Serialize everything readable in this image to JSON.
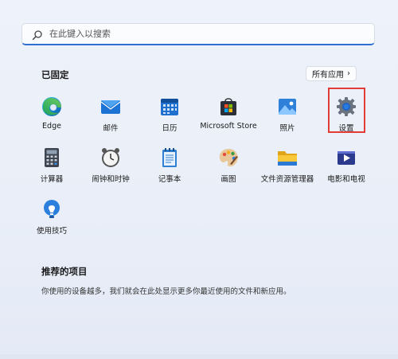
{
  "search": {
    "placeholder": "在此键入以搜索"
  },
  "pinned": {
    "title": "已固定",
    "all_apps_label": "所有应用",
    "all_apps_chevron": "›",
    "apps": [
      {
        "label": "Edge",
        "icon": "edge-icon"
      },
      {
        "label": "邮件",
        "icon": "mail-icon"
      },
      {
        "label": "日历",
        "icon": "calendar-icon"
      },
      {
        "label": "Microsoft Store",
        "icon": "store-icon"
      },
      {
        "label": "照片",
        "icon": "photos-icon"
      },
      {
        "label": "设置",
        "icon": "gear-icon"
      },
      {
        "label": "计算器",
        "icon": "calculator-icon"
      },
      {
        "label": "闹钟和时钟",
        "icon": "clock-icon"
      },
      {
        "label": "记事本",
        "icon": "notepad-icon"
      },
      {
        "label": "画图",
        "icon": "paint-icon"
      },
      {
        "label": "文件资源管理器",
        "icon": "folder-icon"
      },
      {
        "label": "电影和电视",
        "icon": "movies-icon"
      },
      {
        "label": "使用技巧",
        "icon": "tips-icon"
      }
    ]
  },
  "recommended": {
    "title": "推荐的项目",
    "description": "你使用的设备越多，我们就会在此处显示更多你最近使用的文件和新应用。"
  },
  "colors": {
    "accent": "#2f6fd1",
    "highlight": "#e13c38"
  }
}
